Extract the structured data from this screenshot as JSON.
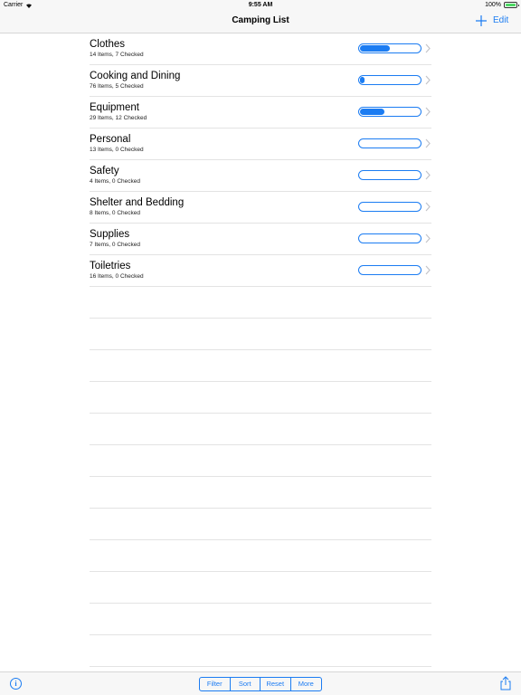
{
  "status_bar": {
    "carrier": "Carrier",
    "time": "9:55 AM",
    "battery": "100%"
  },
  "nav": {
    "title": "Camping List",
    "add_icon": "plus-icon",
    "edit_label": "Edit"
  },
  "list": {
    "items": [
      {
        "title": "Clothes",
        "subtitle": "14 Items, 7 Checked",
        "progress": 0.5
      },
      {
        "title": "Cooking and Dining",
        "subtitle": "76 Items, 5 Checked",
        "progress": 0.07
      },
      {
        "title": "Equipment",
        "subtitle": "29 Items, 12 Checked",
        "progress": 0.41
      },
      {
        "title": "Personal",
        "subtitle": "13 Items, 0 Checked",
        "progress": 0
      },
      {
        "title": "Safety",
        "subtitle": "4 Items, 0 Checked",
        "progress": 0
      },
      {
        "title": "Shelter and Bedding",
        "subtitle": "8 Items, 0 Checked",
        "progress": 0
      },
      {
        "title": "Supplies",
        "subtitle": "7 Items, 0 Checked",
        "progress": 0
      },
      {
        "title": "Toiletries",
        "subtitle": "16 Items, 0 Checked",
        "progress": 0
      }
    ]
  },
  "toolbar": {
    "info_icon": "info-icon",
    "segments": [
      "Filter",
      "Sort",
      "Reset",
      "More"
    ],
    "share_icon": "share-icon"
  },
  "colors": {
    "accent": "#1b7cf2",
    "bar_bg": "#f7f7f7",
    "separator": "#e3e3e3"
  }
}
